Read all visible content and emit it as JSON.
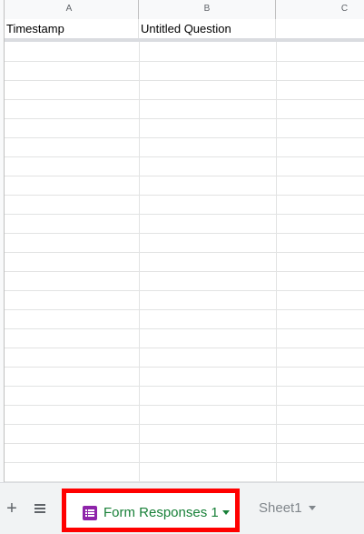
{
  "columns": [
    "A",
    "B",
    "C"
  ],
  "header_row": {
    "a": "Timestamp",
    "b": "Untitled Question",
    "c": ""
  },
  "tabbar": {
    "add_icon": "plus-icon",
    "list_icon": "all-sheets-list-icon",
    "active_tab": {
      "label": "Form Responses 1",
      "icon": "form-icon",
      "icon_color": "#8e24aa",
      "label_color": "#188038"
    },
    "inactive_tab": {
      "label": "Sheet1"
    }
  },
  "highlight_color": "#ff0000"
}
